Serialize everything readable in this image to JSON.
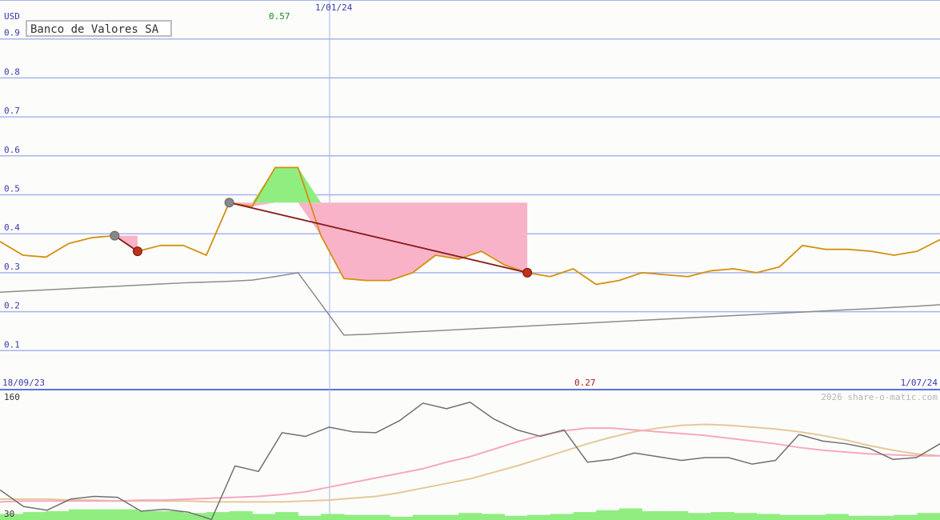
{
  "chart_data": [
    {
      "type": "line",
      "title": "Banco de Valores SA",
      "unit": "USD",
      "ylim": [
        0.0,
        1.0
      ],
      "yticks": [
        "0.9",
        "0.8",
        "0.7",
        "0.6",
        "0.5",
        "0.4",
        "0.3",
        "0.2",
        "0.1"
      ],
      "date_labels": {
        "start": "18/09/23",
        "marker": "1/01/24",
        "end": "1/07/24"
      },
      "high_label": "0.57",
      "low_label": "0.27",
      "grid": true,
      "colors": {
        "price": "#d4900e",
        "ma_long": "#8c8c8c",
        "trend": "#8b1a1a",
        "gain": "#90ee80",
        "loss": "#f9b3c8",
        "grid": "#a8b4ec",
        "axis_text": "#3a3aa8",
        "marker_line": "#9eb4f0"
      },
      "series": [
        {
          "values": [
            0.38,
            0.345,
            0.34,
            0.375,
            0.39,
            0.395,
            0.355,
            0.37,
            0.37,
            0.345,
            0.48,
            0.47,
            0.57,
            0.57,
            0.395,
            0.285,
            0.28,
            0.28,
            0.3,
            0.345,
            0.335,
            0.355,
            0.32,
            0.3,
            0.29,
            0.31,
            0.27,
            0.28,
            0.3,
            0.295,
            0.29,
            0.305,
            0.31,
            0.3,
            0.315,
            0.37,
            0.36,
            0.36,
            0.355,
            0.345,
            0.355,
            0.385
          ]
        },
        {
          "values": [
            0.25,
            0.253,
            0.256,
            0.259,
            0.262,
            0.265,
            0.268,
            0.271,
            0.274,
            0.276,
            0.278,
            0.281,
            0.29,
            0.3,
            0.22,
            0.14,
            0.142,
            0.145,
            0.148,
            0.151,
            0.154,
            0.157,
            0.16,
            0.163,
            0.166,
            0.169,
            0.172,
            0.175,
            0.178,
            0.181,
            0.184,
            0.187,
            0.19,
            0.193,
            0.196,
            0.199,
            0.202,
            0.205,
            0.208,
            0.211,
            0.214,
            0.218
          ]
        }
      ],
      "trades": [
        {
          "start_index": 5,
          "end_index": 6,
          "start": 0.395,
          "end": 0.355
        },
        {
          "start_index": 10,
          "end_index": 23,
          "start": 0.48,
          "end": 0.3
        }
      ]
    },
    {
      "type": "line",
      "ylim": [
        30,
        160
      ],
      "yticks": [
        "160",
        "30"
      ],
      "credit": "2026 share-o-matic.com",
      "series": [
        {
          "values": [
            60,
            42,
            38,
            50,
            53,
            52,
            37,
            39,
            36,
            28,
            86,
            80,
            122,
            118,
            128,
            123,
            122,
            135,
            154,
            148,
            155,
            137,
            125,
            118,
            125,
            90,
            93,
            100,
            96,
            92,
            95,
            95,
            88,
            92,
            120,
            113,
            110,
            105,
            93,
            95,
            110
          ]
        },
        {
          "values": [
            47,
            48,
            48,
            48,
            48,
            48,
            49,
            49,
            50,
            51,
            52,
            53,
            55,
            58,
            63,
            68,
            73,
            78,
            83,
            90,
            96,
            104,
            112,
            119,
            124,
            127,
            127,
            125,
            123,
            121,
            119,
            116,
            113,
            110,
            106,
            103,
            101,
            99,
            98,
            97,
            97
          ]
        },
        {
          "values": [
            50,
            50,
            50,
            49,
            49,
            48,
            48,
            48,
            48,
            47,
            47,
            47,
            47,
            48,
            49,
            51,
            53,
            57,
            62,
            67,
            72,
            79,
            86,
            94,
            102,
            110,
            117,
            123,
            127,
            130,
            131,
            130,
            128,
            126,
            123,
            119,
            114,
            108,
            103,
            99,
            97
          ]
        },
        {
          "values": [
            34,
            36,
            37,
            39,
            39,
            39,
            37,
            37,
            35,
            36,
            37,
            34,
            36,
            32,
            34,
            33,
            33,
            31,
            33,
            33,
            35,
            34,
            32,
            33,
            34,
            36,
            38,
            40,
            37,
            37,
            35,
            36,
            35,
            34,
            33,
            33,
            34,
            32,
            32,
            33,
            35
          ]
        }
      ]
    }
  ]
}
